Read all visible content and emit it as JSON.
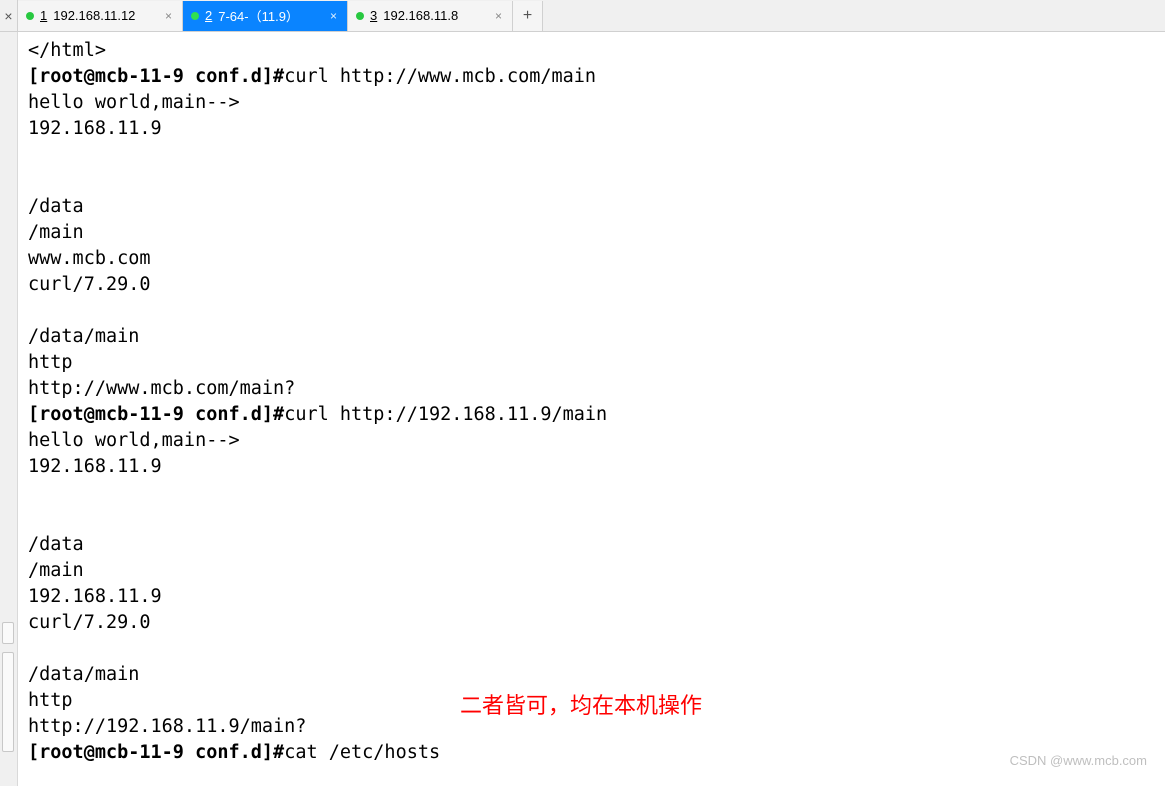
{
  "tabs": [
    {
      "num": "1",
      "label": "192.168.11.12",
      "active": false
    },
    {
      "num": "2",
      "label": "7-64-（11.9）",
      "active": true
    },
    {
      "num": "3",
      "label": "192.168.11.8",
      "active": false
    }
  ],
  "terminal_lines": [
    {
      "t": "</html>",
      "bold": false
    },
    {
      "t": "[root@mcb-11-9 conf.d]#",
      "bold": true,
      "after": "curl http://www.mcb.com/main"
    },
    {
      "t": "hello world,main-->",
      "bold": false
    },
    {
      "t": "192.168.11.9",
      "bold": false
    },
    {
      "t": "",
      "bold": false
    },
    {
      "t": "",
      "bold": false
    },
    {
      "t": "/data",
      "bold": false
    },
    {
      "t": "/main",
      "bold": false
    },
    {
      "t": "www.mcb.com",
      "bold": false
    },
    {
      "t": "curl/7.29.0",
      "bold": false
    },
    {
      "t": "",
      "bold": false
    },
    {
      "t": "/data/main",
      "bold": false
    },
    {
      "t": "http",
      "bold": false
    },
    {
      "t": "http://www.mcb.com/main?",
      "bold": false
    },
    {
      "t": "[root@mcb-11-9 conf.d]#",
      "bold": true,
      "after": "curl http://192.168.11.9/main"
    },
    {
      "t": "hello world,main-->",
      "bold": false
    },
    {
      "t": "192.168.11.9",
      "bold": false
    },
    {
      "t": "",
      "bold": false
    },
    {
      "t": "",
      "bold": false
    },
    {
      "t": "/data",
      "bold": false
    },
    {
      "t": "/main",
      "bold": false
    },
    {
      "t": "192.168.11.9",
      "bold": false
    },
    {
      "t": "curl/7.29.0",
      "bold": false
    },
    {
      "t": "",
      "bold": false
    },
    {
      "t": "/data/main",
      "bold": false
    },
    {
      "t": "http",
      "bold": false
    },
    {
      "t": "http://192.168.11.9/main?",
      "bold": false
    },
    {
      "t": "[root@mcb-11-9 conf.d]#",
      "bold": true,
      "after": "cat /etc/hosts"
    }
  ],
  "annotation": "二者皆可，均在本机操作",
  "watermark": "CSDN @www.mcb.com",
  "side_close_glyph": "×",
  "add_glyph": "+"
}
